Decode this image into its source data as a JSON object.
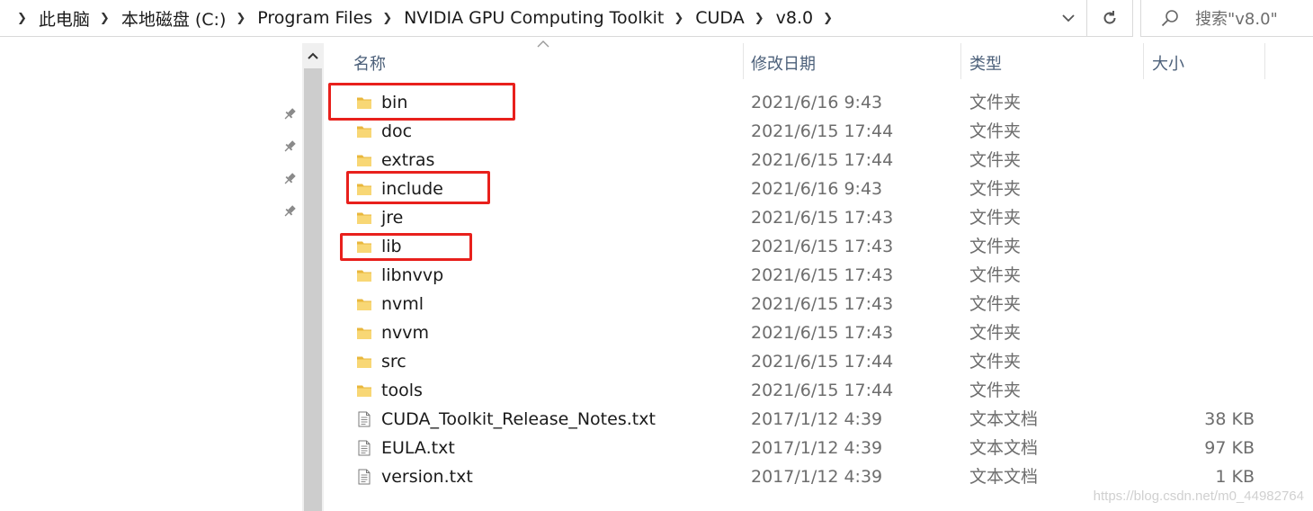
{
  "breadcrumb": [
    "此电脑",
    "本地磁盘 (C:)",
    "Program Files",
    "NVIDIA GPU Computing Toolkit",
    "CUDA",
    "v8.0"
  ],
  "search": {
    "placeholder": "搜索\"v8.0\""
  },
  "columns": {
    "name": "名称",
    "date": "修改日期",
    "type": "类型",
    "size": "大小"
  },
  "rows": [
    {
      "name": "bin",
      "date": "2021/6/16 9:43",
      "type": "文件夹",
      "size": "",
      "kind": "folder",
      "highlighted": true
    },
    {
      "name": "doc",
      "date": "2021/6/15 17:44",
      "type": "文件夹",
      "size": "",
      "kind": "folder"
    },
    {
      "name": "extras",
      "date": "2021/6/15 17:44",
      "type": "文件夹",
      "size": "",
      "kind": "folder"
    },
    {
      "name": "include",
      "date": "2021/6/16 9:43",
      "type": "文件夹",
      "size": "",
      "kind": "folder",
      "highlighted": true
    },
    {
      "name": "jre",
      "date": "2021/6/15 17:43",
      "type": "文件夹",
      "size": "",
      "kind": "folder"
    },
    {
      "name": "lib",
      "date": "2021/6/15 17:43",
      "type": "文件夹",
      "size": "",
      "kind": "folder",
      "highlighted": true
    },
    {
      "name": "libnvvp",
      "date": "2021/6/15 17:43",
      "type": "文件夹",
      "size": "",
      "kind": "folder"
    },
    {
      "name": "nvml",
      "date": "2021/6/15 17:43",
      "type": "文件夹",
      "size": "",
      "kind": "folder"
    },
    {
      "name": "nvvm",
      "date": "2021/6/15 17:43",
      "type": "文件夹",
      "size": "",
      "kind": "folder"
    },
    {
      "name": "src",
      "date": "2021/6/15 17:44",
      "type": "文件夹",
      "size": "",
      "kind": "folder"
    },
    {
      "name": "tools",
      "date": "2021/6/15 17:44",
      "type": "文件夹",
      "size": "",
      "kind": "folder"
    },
    {
      "name": "CUDA_Toolkit_Release_Notes.txt",
      "date": "2017/1/12 4:39",
      "type": "文本文档",
      "size": "38 KB",
      "kind": "text-file"
    },
    {
      "name": "EULA.txt",
      "date": "2017/1/12 4:39",
      "type": "文本文档",
      "size": "97 KB",
      "kind": "text-file"
    },
    {
      "name": "version.txt",
      "date": "2017/1/12 4:39",
      "type": "文本文档",
      "size": "1 KB",
      "kind": "text-file"
    }
  ],
  "colors": {
    "highlight": "#e8201c",
    "folder": "#f8d775",
    "folder_dark": "#e9b73c"
  },
  "icons": {
    "folder": "folder-icon",
    "text-file": "text-file-icon",
    "pin": "pin-icon",
    "search": "search-icon",
    "refresh": "refresh-icon",
    "dropdown": "chevron-down-icon"
  },
  "watermark": "https://blog.csdn.net/m0_44982764"
}
